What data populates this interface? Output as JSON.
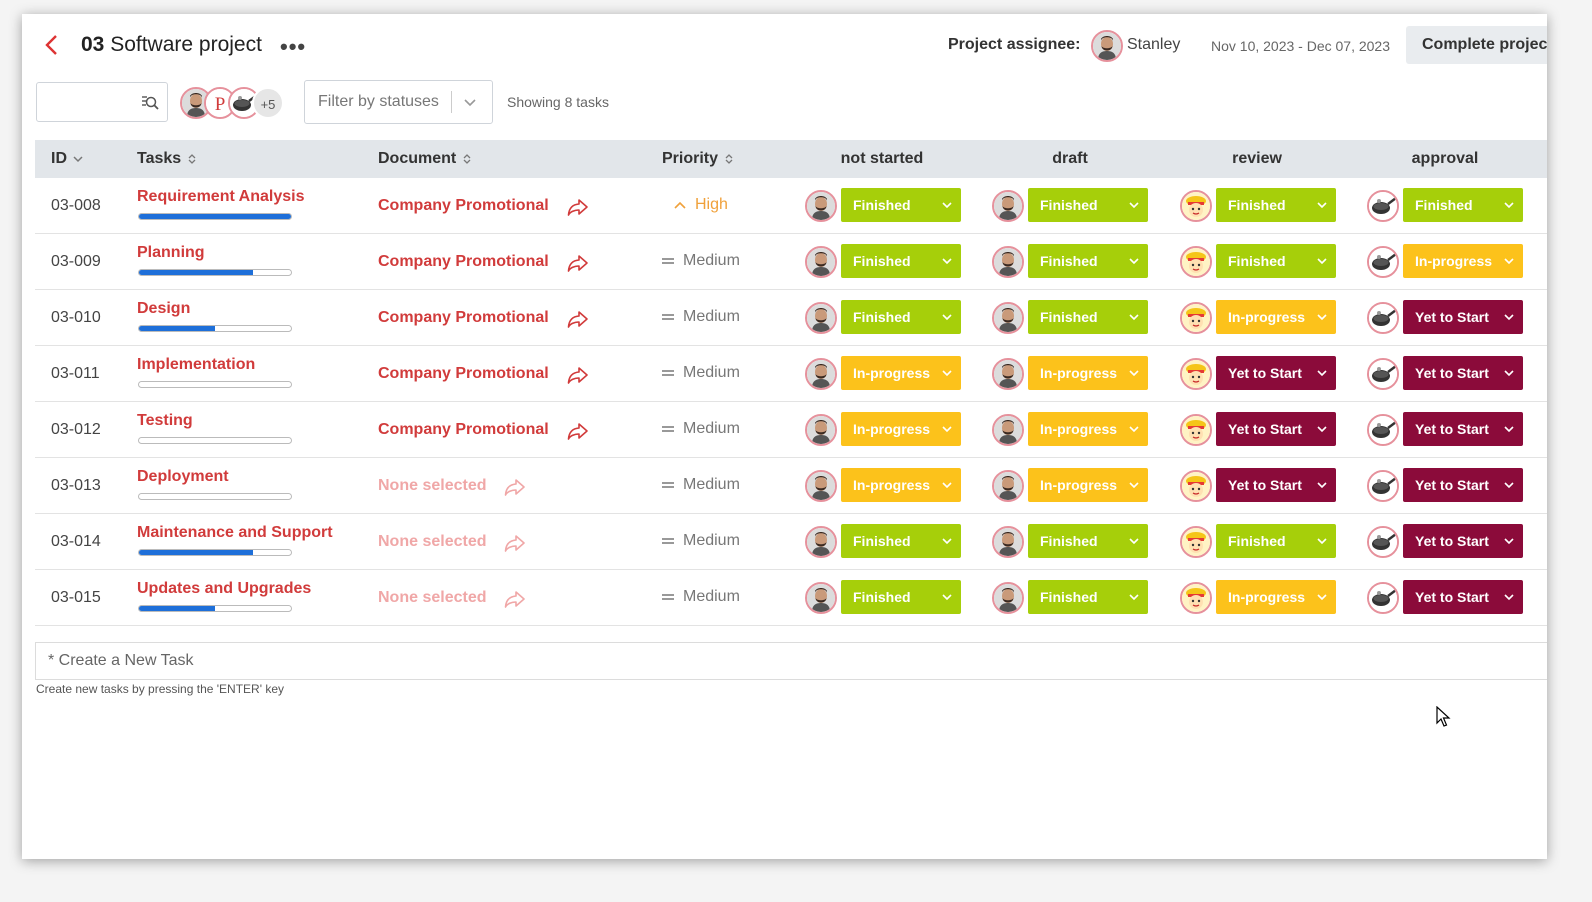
{
  "header": {
    "title_prefix": "03",
    "title": "Software project",
    "more_label": "•••",
    "assignee_label": "Project assignee:",
    "assignee_name": "Stanley",
    "date_range": "Nov 10, 2023 - Dec 07, 2023",
    "complete_button": "Complete project"
  },
  "toolbar": {
    "search_value": "",
    "members_extra": "+5",
    "filter_placeholder": "Filter by statuses",
    "showing": "Showing 8 tasks"
  },
  "columns": {
    "id": "ID",
    "tasks": "Tasks",
    "document": "Document",
    "priority": "Priority",
    "stages": [
      "not started",
      "draft",
      "review",
      "approval"
    ]
  },
  "stage_avatars": [
    "man-beard-avatar",
    "man-beard-avatar",
    "cartoon-chef-avatar",
    "wok-pan-avatar"
  ],
  "status_colors": {
    "Finished": "#a6cf0a",
    "In-progress": "#fcc21b",
    "Yet to Start": "#8b0b3a"
  },
  "tasks": [
    {
      "id": "03-008",
      "name": "Requirement Analysis",
      "progress": 1.0,
      "document": "Company Promotional",
      "doc_set": true,
      "priority": "High",
      "statuses": [
        "Finished",
        "Finished",
        "Finished",
        "Finished"
      ]
    },
    {
      "id": "03-009",
      "name": "Planning",
      "progress": 0.75,
      "document": "Company Promotional",
      "doc_set": true,
      "priority": "Medium",
      "statuses": [
        "Finished",
        "Finished",
        "Finished",
        "In-progress"
      ]
    },
    {
      "id": "03-010",
      "name": "Design",
      "progress": 0.5,
      "document": "Company Promotional",
      "doc_set": true,
      "priority": "Medium",
      "statuses": [
        "Finished",
        "Finished",
        "In-progress",
        "Yet to Start"
      ]
    },
    {
      "id": "03-011",
      "name": "Implementation",
      "progress": 0,
      "document": "Company Promotional",
      "doc_set": true,
      "priority": "Medium",
      "statuses": [
        "In-progress",
        "In-progress",
        "Yet to Start",
        "Yet to Start"
      ]
    },
    {
      "id": "03-012",
      "name": "Testing",
      "progress": 0,
      "document": "Company Promotional",
      "doc_set": true,
      "priority": "Medium",
      "statuses": [
        "In-progress",
        "In-progress",
        "Yet to Start",
        "Yet to Start"
      ]
    },
    {
      "id": "03-013",
      "name": "Deployment",
      "progress": 0,
      "document": "None selected",
      "doc_set": false,
      "priority": "Medium",
      "statuses": [
        "In-progress",
        "In-progress",
        "Yet to Start",
        "Yet to Start"
      ]
    },
    {
      "id": "03-014",
      "name": "Maintenance and Support",
      "progress": 0.75,
      "document": "None selected",
      "doc_set": false,
      "priority": "Medium",
      "statuses": [
        "Finished",
        "Finished",
        "Finished",
        "Yet to Start"
      ]
    },
    {
      "id": "03-015",
      "name": "Updates and Upgrades",
      "progress": 0.5,
      "document": "None selected",
      "doc_set": false,
      "priority": "Medium",
      "statuses": [
        "Finished",
        "Finished",
        "In-progress",
        "Yet to Start"
      ]
    }
  ],
  "new_task": {
    "placeholder": "* Create a New Task",
    "hint": "Create new tasks by pressing the 'ENTER' key"
  }
}
